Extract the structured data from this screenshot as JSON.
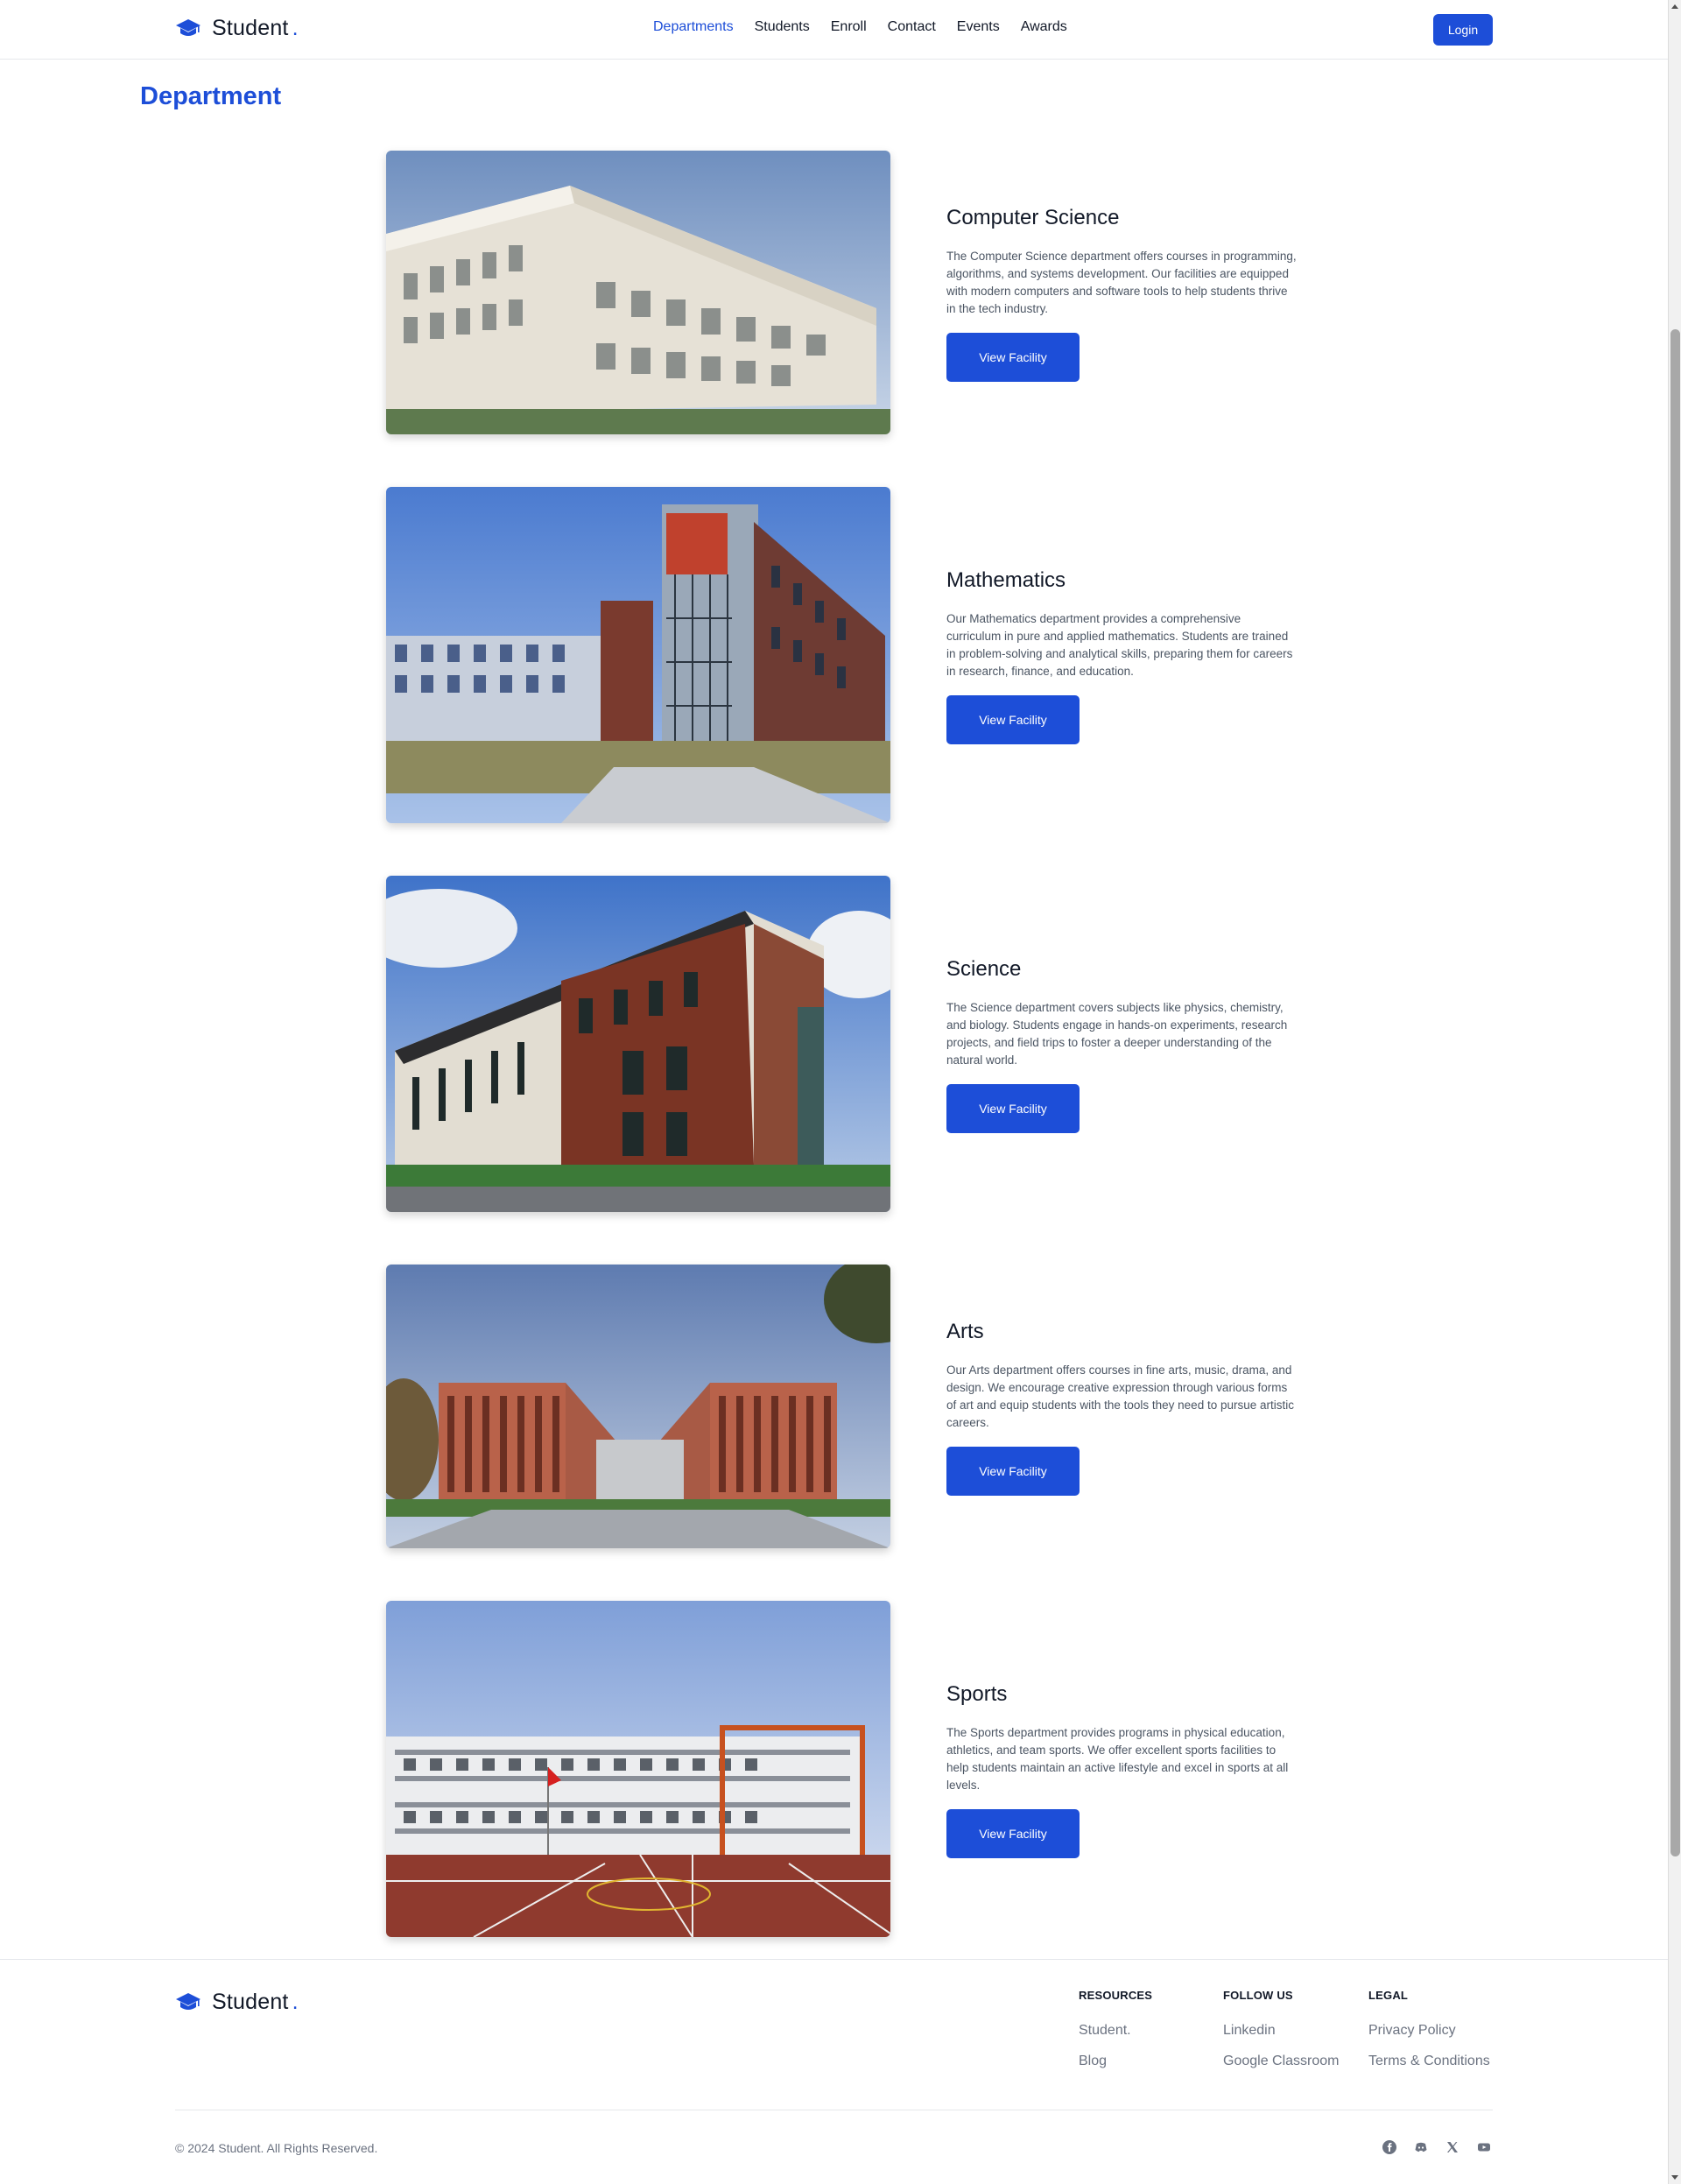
{
  "header": {
    "brand": "Student",
    "brand_dot": ".",
    "nav": [
      "Departments",
      "Students",
      "Enroll",
      "Contact",
      "Events",
      "Awards"
    ],
    "active_nav": "Departments",
    "login_label": "Login"
  },
  "page_title": "Department",
  "departments": [
    {
      "name": "Computer Science",
      "description": "The Computer Science department offers courses in programming, algorithms, and systems development. Our facilities are equipped with modern computers and software tools to help students thrive in the tech industry.",
      "button": "View Facility"
    },
    {
      "name": "Mathematics",
      "description": "Our Mathematics department provides a comprehensive curriculum in pure and applied mathematics. Students are trained in problem-solving and analytical skills, preparing them for careers in research, finance, and education.",
      "button": "View Facility"
    },
    {
      "name": "Science",
      "description": "The Science department covers subjects like physics, chemistry, and biology. Students engage in hands-on experiments, research projects, and field trips to foster a deeper understanding of the natural world.",
      "button": "View Facility"
    },
    {
      "name": "Arts",
      "description": "Our Arts department offers courses in fine arts, music, drama, and design. We encourage creative expression through various forms of art and equip students with the tools they need to pursue artistic careers.",
      "button": "View Facility"
    },
    {
      "name": "Sports",
      "description": "The Sports department provides programs in physical education, athletics, and team sports. We offer excellent sports facilities to help students maintain an active lifestyle and excel in sports at all levels.",
      "button": "View Facility"
    }
  ],
  "footer": {
    "brand": "Student",
    "brand_dot": ".",
    "columns": [
      {
        "heading": "RESOURCES",
        "links": [
          "Student.",
          "Blog"
        ]
      },
      {
        "heading": "FOLLOW US",
        "links": [
          "Linkedin",
          "Google Classroom"
        ]
      },
      {
        "heading": "LEGAL",
        "links": [
          "Privacy Policy",
          "Terms & Conditions"
        ]
      }
    ],
    "copyright": "© 2024 Student. All Rights Reserved.",
    "socials": [
      "facebook-icon",
      "discord-icon",
      "x-icon",
      "youtube-icon"
    ]
  },
  "colors": {
    "accent": "#1d4ed8",
    "text": "#111827",
    "muted": "#6b7280"
  }
}
